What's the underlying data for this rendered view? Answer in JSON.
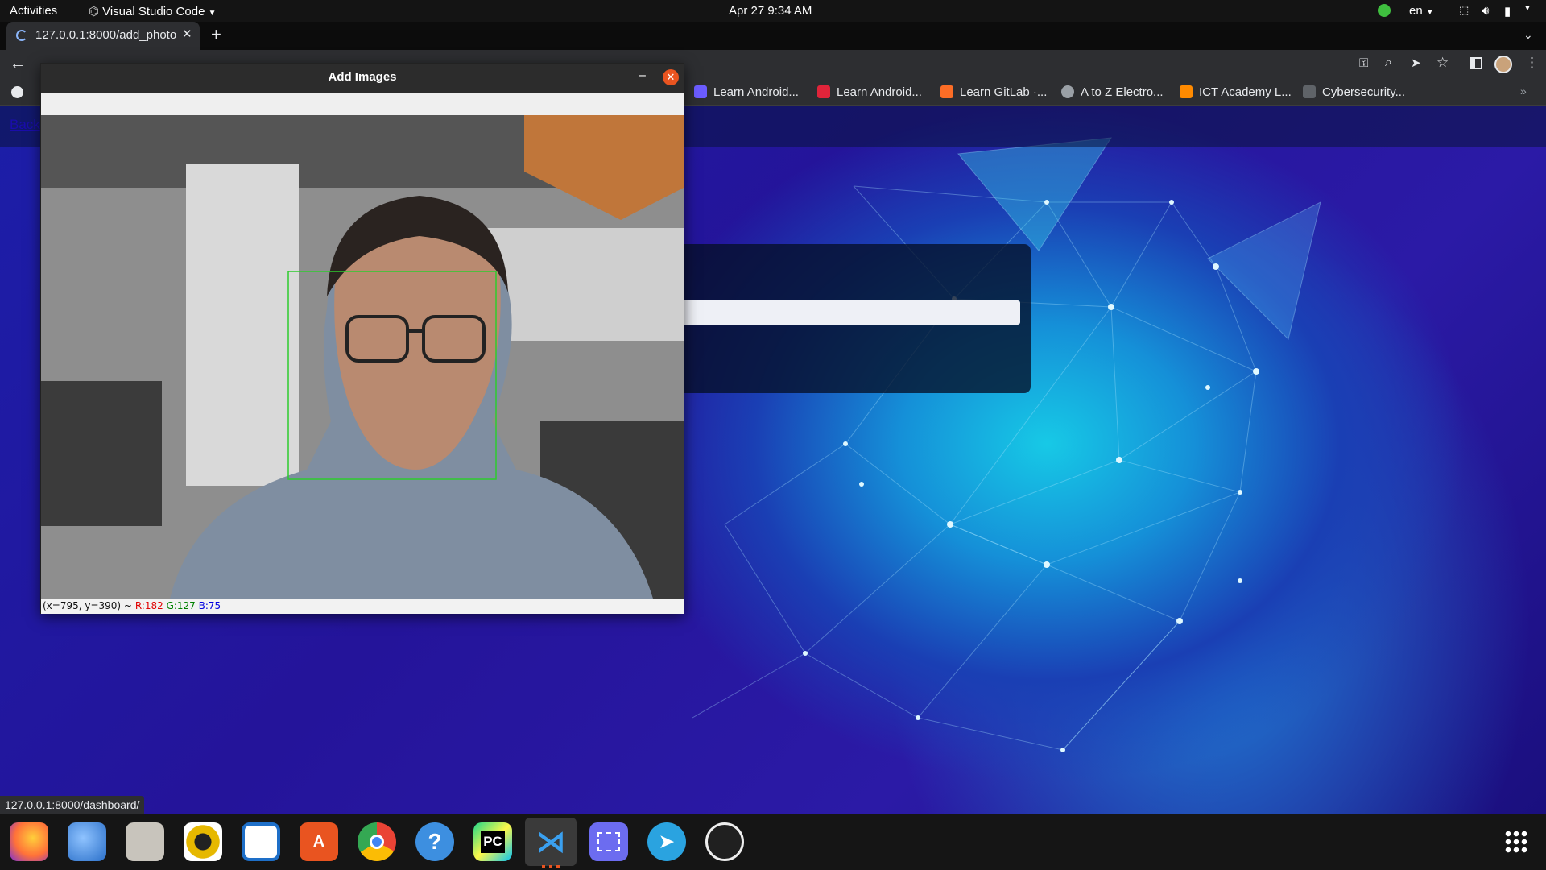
{
  "topbar": {
    "activities": "Activities",
    "app_menu": "Visual Studio Code",
    "datetime": "Apr 27  9:34 AM",
    "lang": "en"
  },
  "browser": {
    "tab_title": "127.0.0.1:8000/add_photo",
    "bookmarks": [
      {
        "label": "Learn Android...",
        "color": "#6b5cff"
      },
      {
        "label": "Learn Android...",
        "color": "#e0243a"
      },
      {
        "label": "Learn GitLab ·...",
        "color": "#fc6d26"
      },
      {
        "label": "A to Z Electro...",
        "color": "#9aa0a6"
      },
      {
        "label": "ICT Academy L...",
        "color": "#ff8a00"
      },
      {
        "label": "Cybersecurity...",
        "color": "#5f6368"
      }
    ],
    "back_link": "Back",
    "status_url": "127.0.0.1:8000/dashboard/"
  },
  "opencv_window": {
    "title": "Add Images",
    "coords": "(x=795, y=390) ~",
    "r": "R:182",
    "g": "G:127",
    "b": "B:75",
    "colors": {
      "r": "#e00000",
      "g": "#008000",
      "b": "#0000e0",
      "face_box": "#2ecc2e"
    }
  },
  "dock": {
    "apps": [
      {
        "name": "firefox-icon",
        "color": "#ff7139",
        "glyph": ""
      },
      {
        "name": "thunderbird-icon",
        "color": "#2a6fc9",
        "glyph": ""
      },
      {
        "name": "files-icon",
        "color": "#c8c4bc",
        "glyph": ""
      },
      {
        "name": "rhythmbox-icon",
        "color": "#e6b800",
        "glyph": ""
      },
      {
        "name": "writer-icon",
        "color": "#1e6fc8",
        "glyph": ""
      },
      {
        "name": "software-icon",
        "color": "#e95420",
        "glyph": ""
      },
      {
        "name": "chrome-icon",
        "color": "#e8eaed",
        "glyph": ""
      },
      {
        "name": "help-icon",
        "color": "#3d8fe0",
        "glyph": "?"
      },
      {
        "name": "pycharm-icon",
        "color": "#21d789",
        "glyph": "PC"
      },
      {
        "name": "vscode-icon",
        "color": "#3a3a3a",
        "glyph": ""
      },
      {
        "name": "screenshot-icon",
        "color": "#6c6cf0",
        "glyph": ""
      },
      {
        "name": "telegram-icon",
        "color": "#2aa3e0",
        "glyph": ""
      },
      {
        "name": "obs-icon",
        "color": "#202020",
        "glyph": ""
      }
    ]
  }
}
